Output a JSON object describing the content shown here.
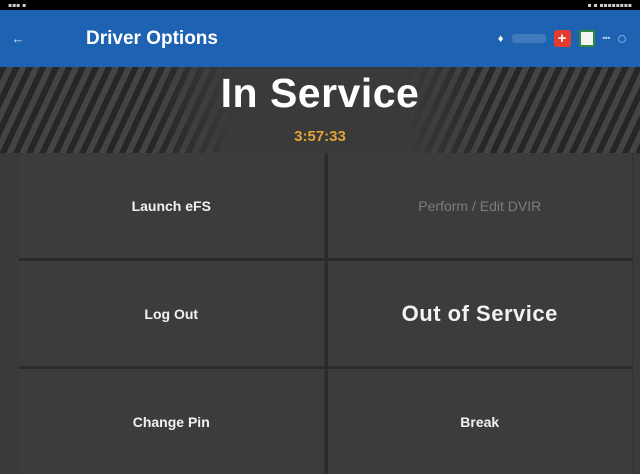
{
  "app_bar": {
    "title": "Driver Options"
  },
  "header": {
    "status_title": "In Service",
    "timer": "3:57:33"
  },
  "tiles": [
    {
      "label": "Launch eFS",
      "enabled": true
    },
    {
      "label": "Perform / Edit DVIR",
      "enabled": false
    },
    {
      "label": "Log Out",
      "enabled": true
    },
    {
      "label": "Out of Service",
      "enabled": true
    },
    {
      "label": "Change Pin",
      "enabled": true
    },
    {
      "label": "Break",
      "enabled": true
    }
  ],
  "icons": {
    "back": "back-arrow-icon",
    "signal": "signal-icon",
    "alert": "medical-cross-icon",
    "sheet": "spreadsheet-icon",
    "sync": "sync-icon"
  },
  "colors": {
    "app_bar": "#1e63b2",
    "timer": "#e0a534",
    "alert": "#e53a2e"
  }
}
